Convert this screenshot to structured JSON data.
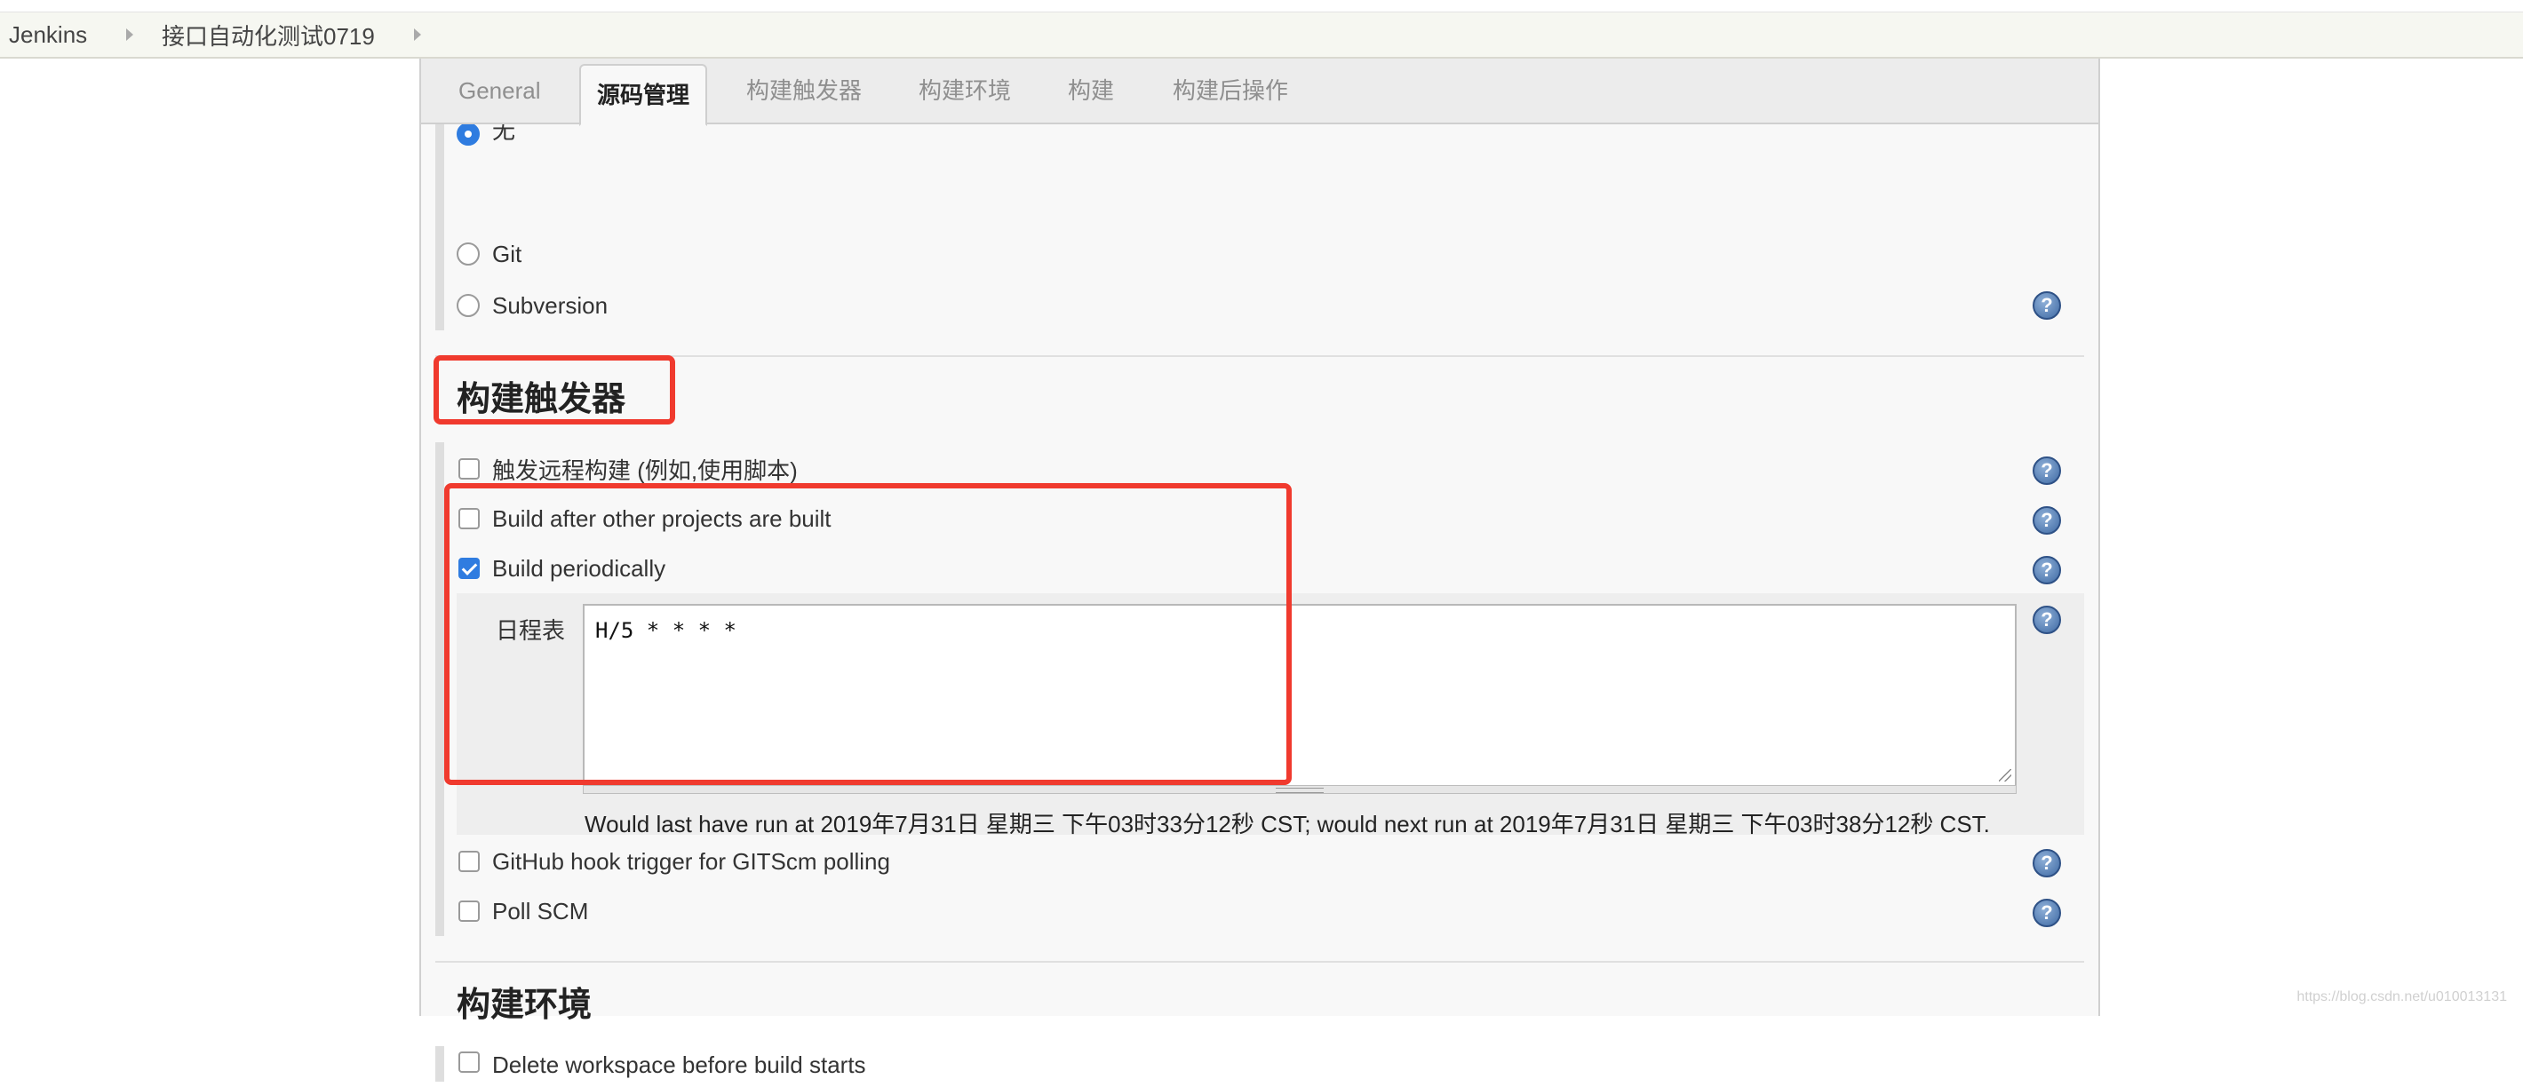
{
  "breadcrumb": {
    "items": [
      "Jenkins",
      "接口自动化测试0719"
    ]
  },
  "tabs": [
    "General",
    "源码管理",
    "构建触发器",
    "构建环境",
    "构建",
    "构建后操作"
  ],
  "active_tab": "源码管理",
  "scm": {
    "options": [
      {
        "label": "无",
        "selected": true
      },
      {
        "label": "Git",
        "selected": false
      },
      {
        "label": "Subversion",
        "selected": false
      }
    ]
  },
  "triggers": {
    "title": "构建触发器",
    "items": [
      {
        "label": "触发远程构建 (例如,使用脚本)",
        "checked": false
      },
      {
        "label": "Build after other projects are built",
        "checked": false
      },
      {
        "label": "Build periodically",
        "checked": true
      },
      {
        "label": "GitHub hook trigger for GITScm polling",
        "checked": false
      },
      {
        "label": "Poll SCM",
        "checked": false
      }
    ],
    "schedule": {
      "label": "日程表",
      "value": "H/5 * * * *",
      "info": "Would last have run at 2019年7月31日 星期三 下午03时33分12秒 CST; would next run at 2019年7月31日 星期三 下午03时38分12秒 CST."
    }
  },
  "build_env": {
    "title": "构建环境",
    "items": [
      {
        "label": "Delete workspace before build starts",
        "checked": false
      }
    ]
  },
  "help_glyph": "?",
  "icons": {
    "help": "help-icon",
    "breadcrumb_arrow": "chevron-right-icon"
  },
  "colors": {
    "highlight": "#f03a2e",
    "accent": "#2f7ce0",
    "help": "#3f6aa4"
  },
  "watermark": "https://blog.csdn.net/u010013131"
}
